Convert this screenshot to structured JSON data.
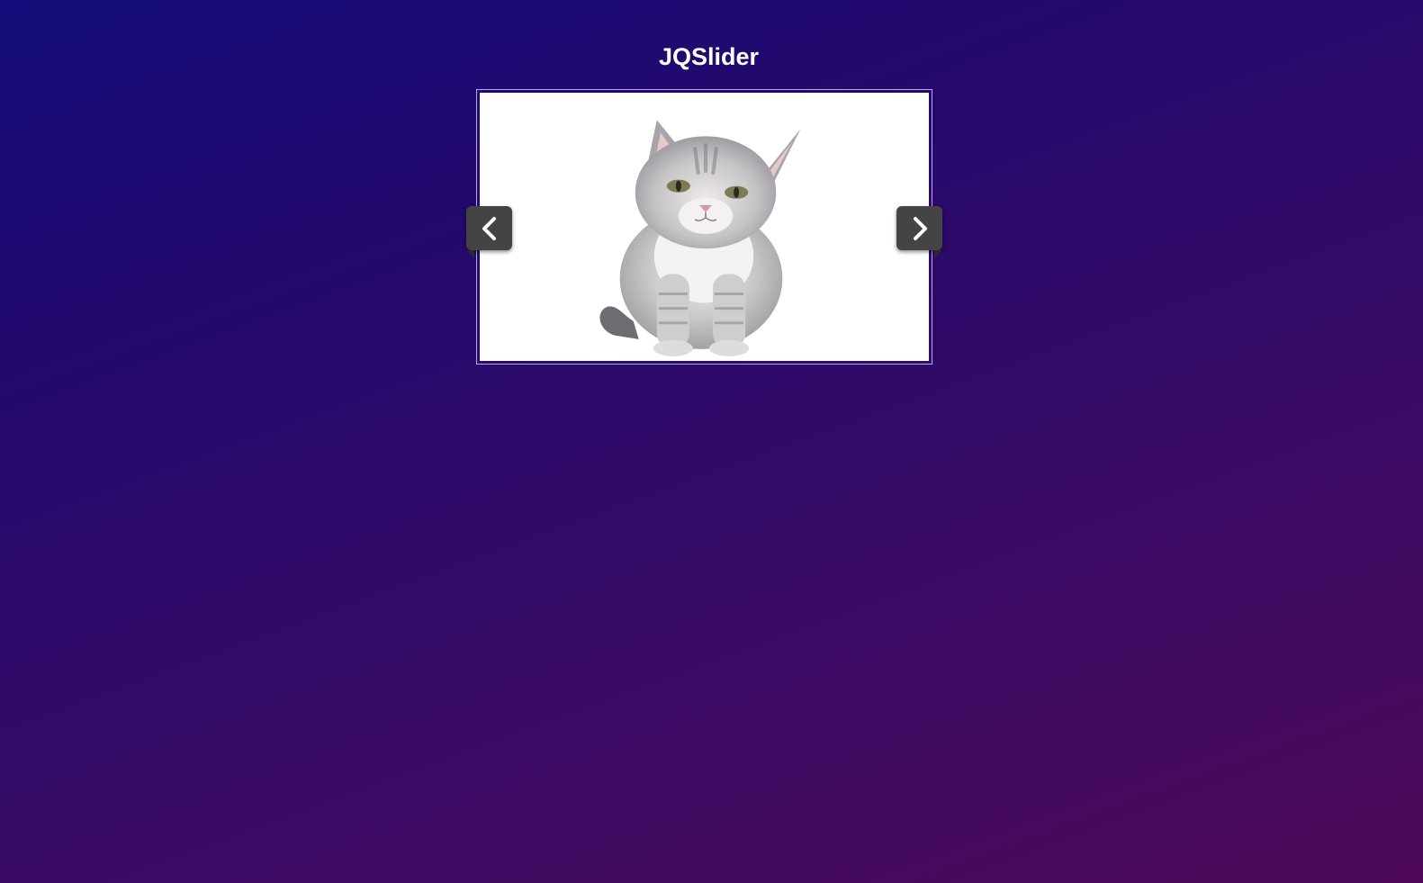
{
  "page": {
    "title": "JQSlider"
  },
  "slider": {
    "current_slide": "kitten",
    "prev_icon": "chevron-left-icon",
    "next_icon": "chevron-right-icon"
  },
  "colors": {
    "background_start": "#140c7a",
    "background_end": "#4e0a58",
    "button_bg": "#444444",
    "frame_border": "#b9a9e8",
    "title": "#ffffff"
  }
}
